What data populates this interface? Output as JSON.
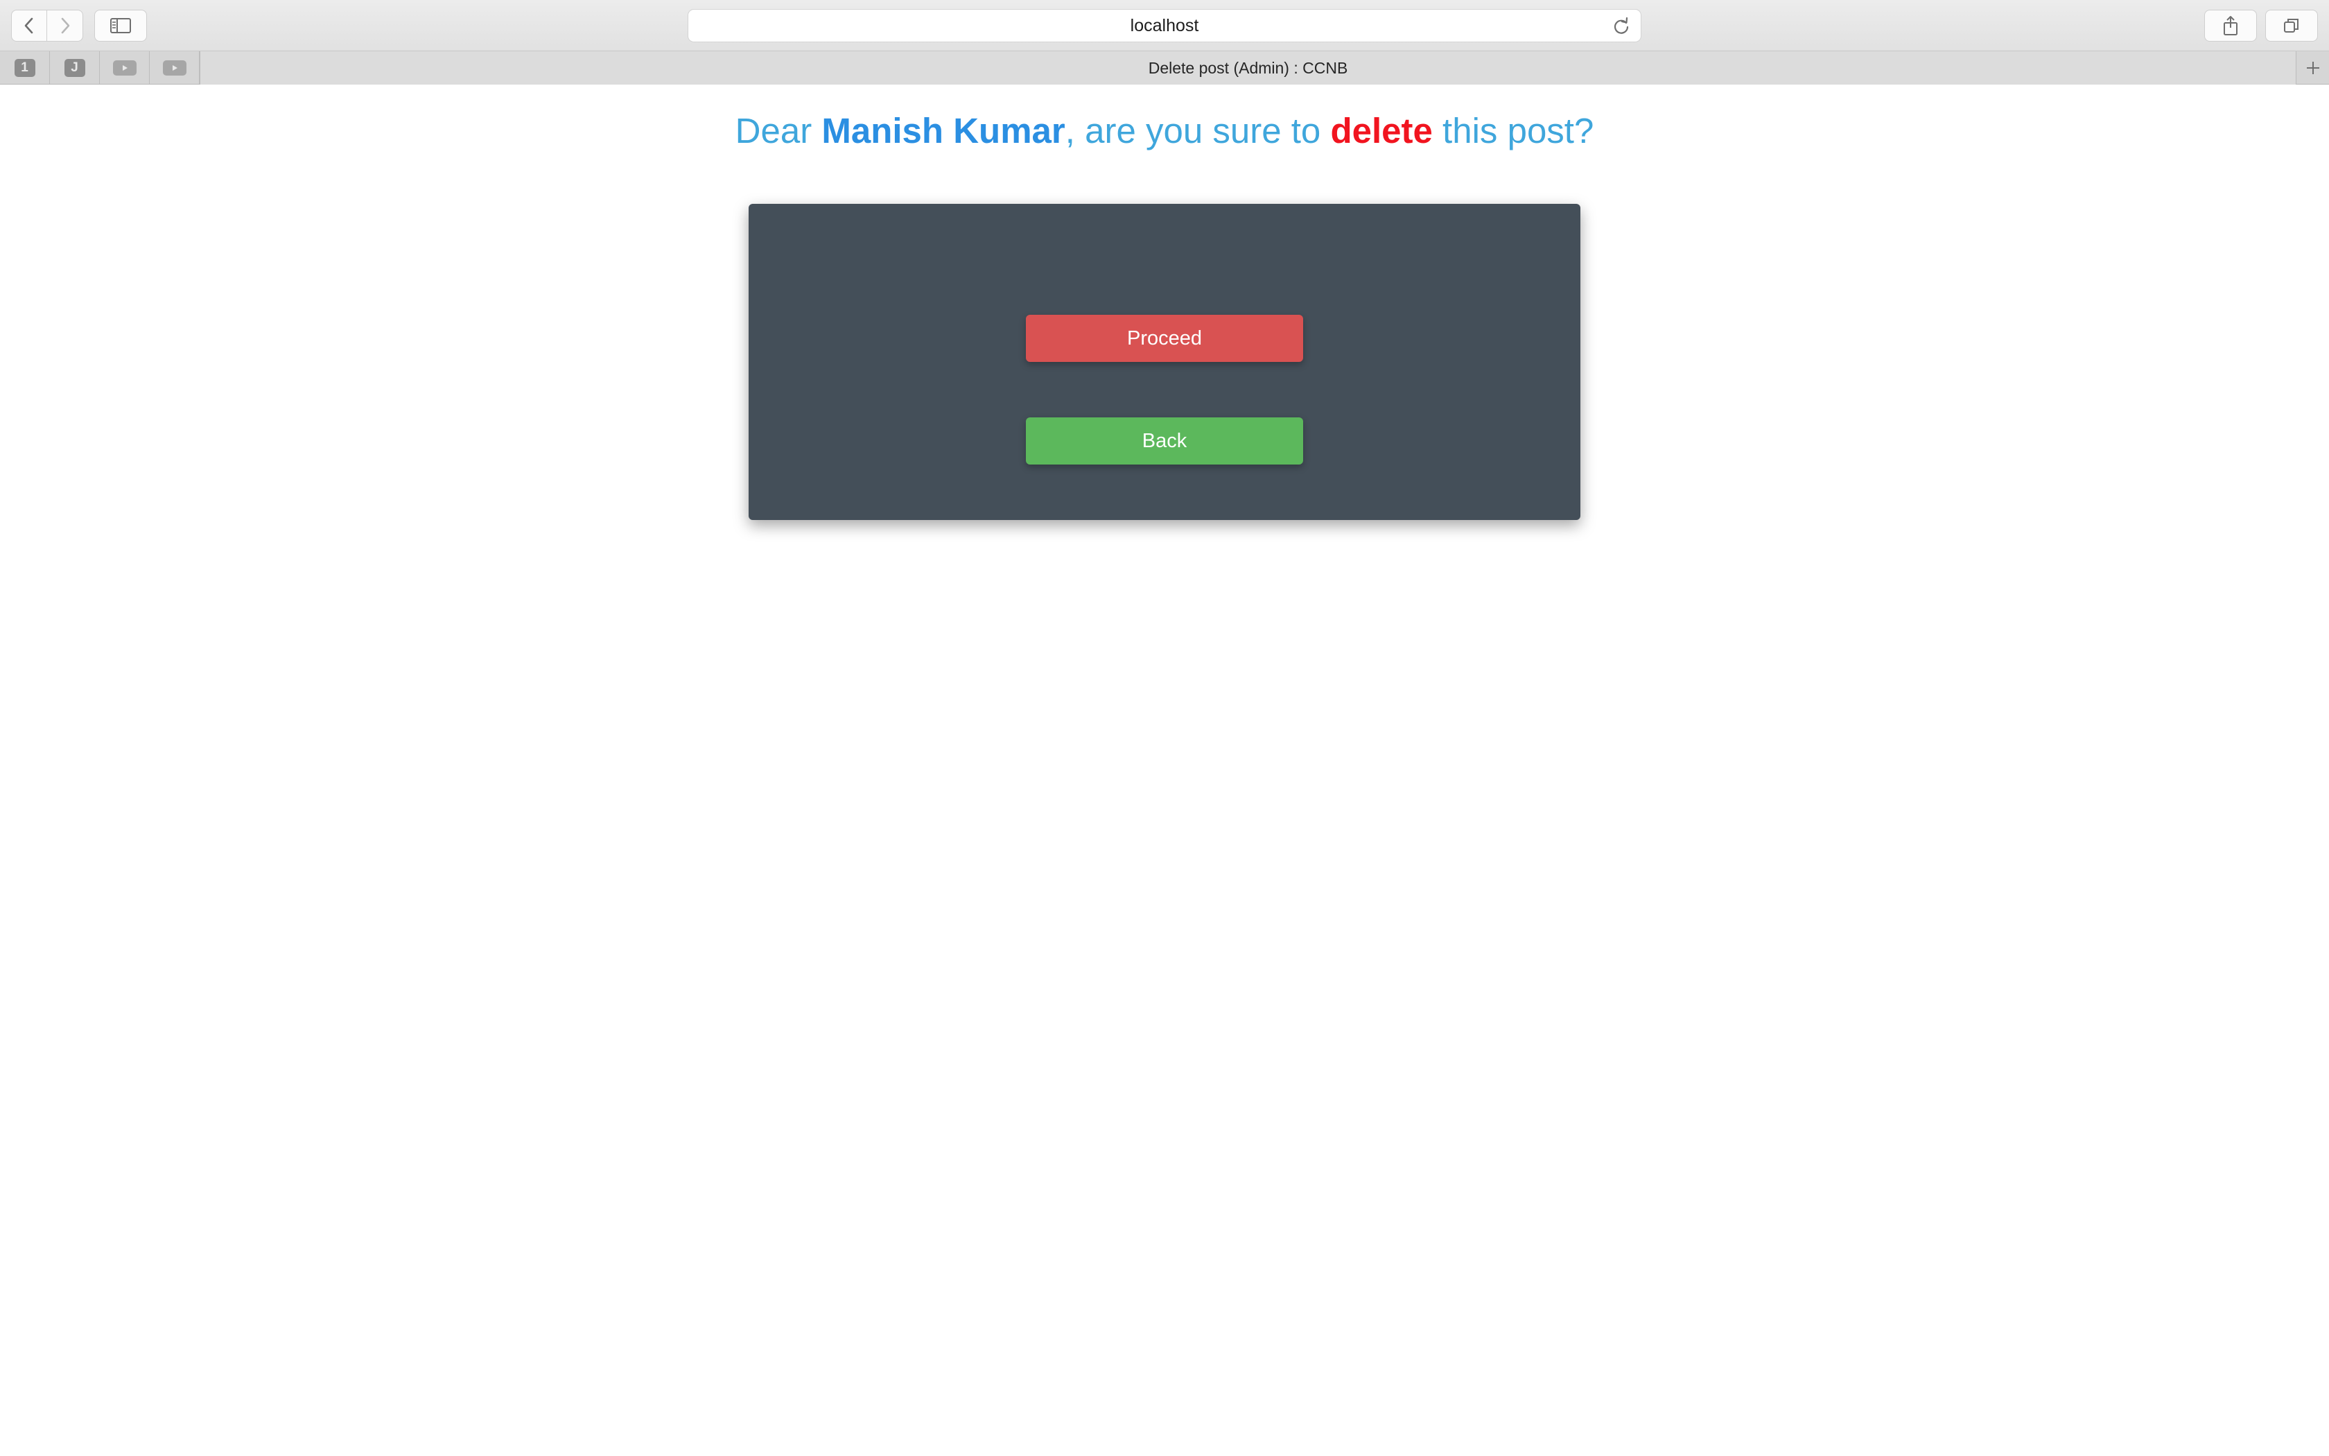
{
  "browser": {
    "address": "localhost",
    "tab_title": "Delete post (Admin) : CCNB",
    "pinned_tabs": [
      "1",
      "J",
      "youtube",
      "youtube"
    ]
  },
  "page": {
    "greeting": "Dear",
    "username": "Manish Kumar",
    "question_part1": ", are you sure to",
    "action_word": "delete",
    "question_part2": "this post?",
    "proceed_label": "Proceed",
    "back_label": "Back"
  },
  "colors": {
    "heading": "#3fa6dc",
    "username": "#2b8fe2",
    "danger_word": "#f1141f",
    "panel": "#444f59",
    "proceed": "#d95252",
    "back": "#5cb85c"
  },
  "icons": {
    "back": "chevron-left-icon",
    "forward": "chevron-right-icon",
    "sidebar": "sidebar-icon",
    "reload": "reload-icon",
    "share": "share-icon",
    "tabs": "tabs-overview-icon",
    "new_tab": "plus-icon"
  }
}
